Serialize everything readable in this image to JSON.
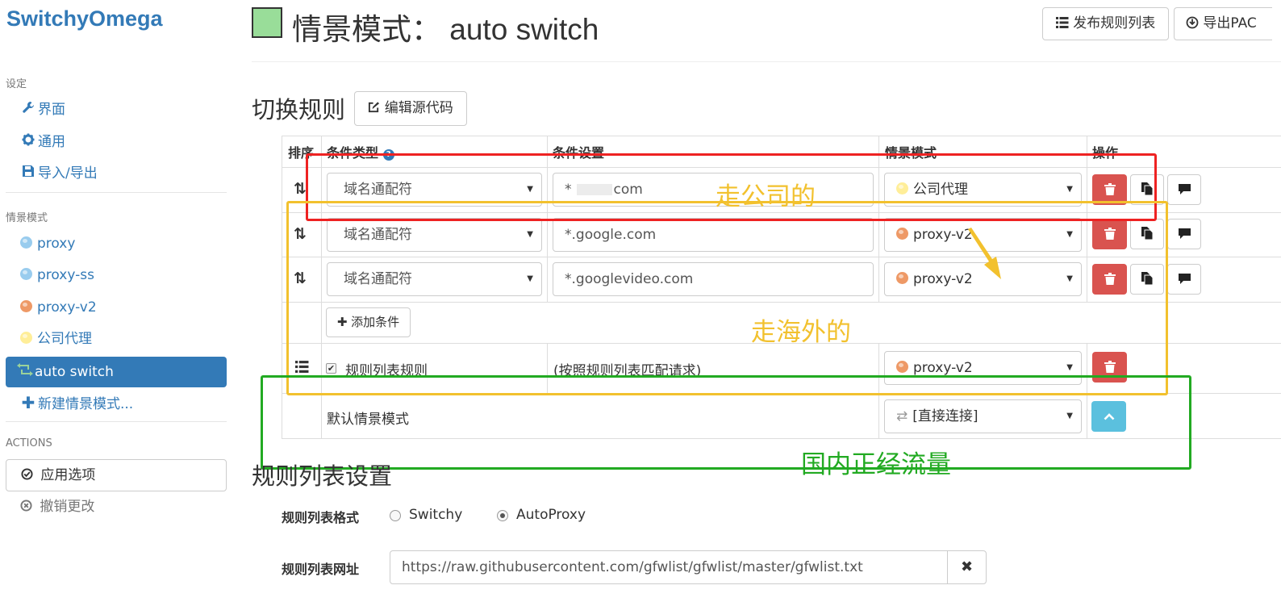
{
  "brand": "SwitchyOmega",
  "sidebar": {
    "settings_header": "设定",
    "settings_items": [
      {
        "label": "界面",
        "icon": "wrench-icon"
      },
      {
        "label": "通用",
        "icon": "gear-icon"
      },
      {
        "label": "导入/导出",
        "icon": "floppy-icon"
      }
    ],
    "profiles_header": "情景模式",
    "profiles": [
      {
        "label": "proxy",
        "color": "#99ccee"
      },
      {
        "label": "proxy-ss",
        "color": "#99ccee"
      },
      {
        "label": "proxy-v2",
        "color": "#ee9966"
      },
      {
        "label": "公司代理",
        "color": "#ffee99"
      }
    ],
    "active_profile": "auto switch",
    "new_profile": "新建情景模式...",
    "actions_header": "ACTIONS",
    "apply": "应用选项",
    "undo": "撤销更改"
  },
  "header": {
    "swatch_color": "#99dd99",
    "title": "情景模式： auto switch",
    "publish_button": "发布规则列表",
    "export_button": "导出PAC"
  },
  "rules": {
    "section_title": "切换规则",
    "edit_source_button": "编辑源代码",
    "columns": {
      "sort": "排序",
      "condition_type": "条件类型",
      "condition_settings": "条件设置",
      "profile": "情景模式",
      "actions": "操作"
    },
    "rows": [
      {
        "type": "域名通配符",
        "pattern_prefix": "*",
        "pattern_suffix": "com",
        "profile": "公司代理",
        "profile_color": "#ffee99"
      },
      {
        "type": "域名通配符",
        "pattern": "*.google.com",
        "profile": "proxy-v2",
        "profile_color": "#ee9966"
      },
      {
        "type": "域名通配符",
        "pattern": "*.googlevideo.com",
        "profile": "proxy-v2",
        "profile_color": "#ee9966"
      }
    ],
    "add_condition": "添加条件",
    "rule_list_row": {
      "label": "规则列表规则",
      "checked": true,
      "description": "(按照规则列表匹配请求)",
      "profile": "proxy-v2",
      "profile_color": "#ee9966"
    },
    "default_row": {
      "label": "默认情景模式",
      "profile": "[直接连接]"
    }
  },
  "annotations": {
    "company": {
      "text": "走公司的",
      "color": "#f2c12e"
    },
    "overseas": {
      "text": "走海外的",
      "color": "#f2c12e"
    },
    "domestic": {
      "text": "国内正经流量",
      "color": "#22aa22"
    },
    "red_box_color": "#ee2222",
    "yellow_box_color": "#f2c12e",
    "green_box_color": "#22aa22"
  },
  "rule_list_settings": {
    "section_title": "规则列表设置",
    "format_label": "规则列表格式",
    "format_options": [
      "Switchy",
      "AutoProxy"
    ],
    "format_selected": "AutoProxy",
    "url_label": "规则列表网址",
    "url_value": "https://raw.githubusercontent.com/gfwlist/gfwlist/master/gfwlist.txt"
  }
}
